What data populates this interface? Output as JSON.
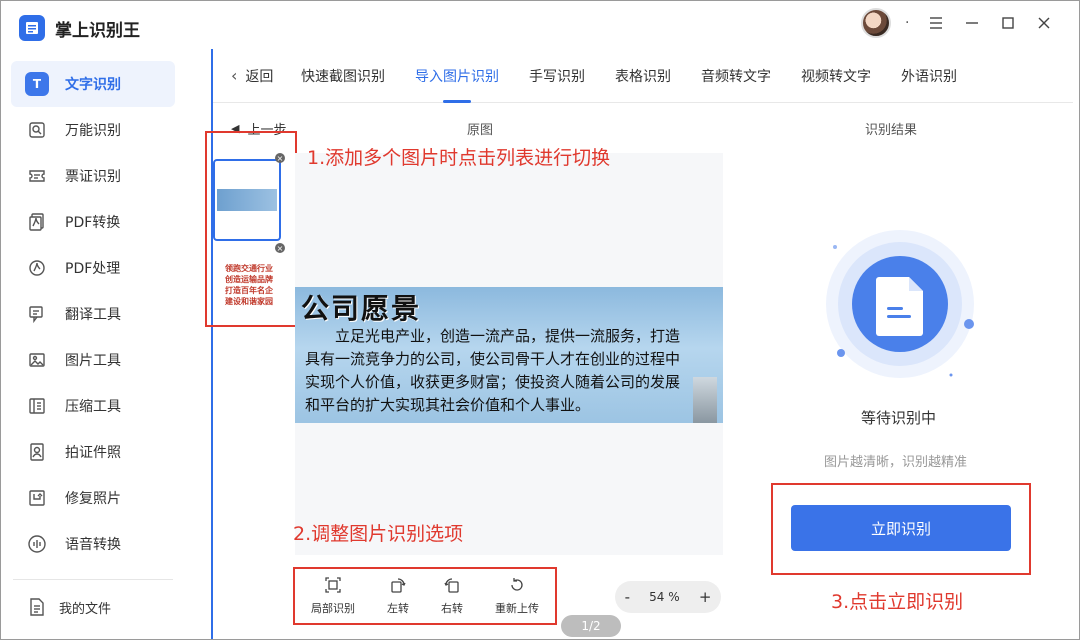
{
  "app": {
    "title": "掌上识别王"
  },
  "sidebar": {
    "items": [
      {
        "label": "文字识别",
        "icon": "text-recognition-icon",
        "active": true
      },
      {
        "label": "万能识别",
        "icon": "universal-scan-icon"
      },
      {
        "label": "票证识别",
        "icon": "ticket-icon"
      },
      {
        "label": "PDF转换",
        "icon": "pdf-convert-icon"
      },
      {
        "label": "PDF处理",
        "icon": "pdf-process-icon"
      },
      {
        "label": "翻译工具",
        "icon": "translate-icon"
      },
      {
        "label": "图片工具",
        "icon": "image-tools-icon"
      },
      {
        "label": "压缩工具",
        "icon": "compress-icon"
      },
      {
        "label": "拍证件照",
        "icon": "id-photo-icon"
      },
      {
        "label": "修复照片",
        "icon": "repair-photo-icon"
      },
      {
        "label": "语音转换",
        "icon": "voice-convert-icon"
      }
    ],
    "my_files": "我的文件",
    "active_icon_letter": "T"
  },
  "winbar": {
    "dot": "·"
  },
  "tabs": {
    "back": "返回",
    "items": [
      {
        "label": "快速截图识别"
      },
      {
        "label": "导入图片识别",
        "active": true
      },
      {
        "label": "手写识别"
      },
      {
        "label": "表格识别"
      },
      {
        "label": "音频转文字"
      },
      {
        "label": "视频转文字"
      },
      {
        "label": "外语识别"
      }
    ]
  },
  "workspace": {
    "prev_step": "上一步",
    "original_label": "原图",
    "result_label": "识别结果",
    "page_indicator": "1/2",
    "zoom": {
      "minus": "-",
      "value": "54 %",
      "plus": "+"
    }
  },
  "thumbnails": {
    "thumb2_lines": [
      "领跑交通行业",
      "创造运输品牌",
      "打造百年名企",
      "建设和谐家园"
    ]
  },
  "image_content": {
    "title": "公司愿景",
    "lines": [
      "立足光电产业，创造一流产品，提供一流服务，打造",
      "具有一流竞争力的公司，使公司骨干人才在创业的过程中",
      "实现个人价值，收获更多财富；使投资人随着公司的发展",
      "和平台的扩大实现其社会价值和个人事业。"
    ]
  },
  "tools": [
    {
      "label": "局部识别",
      "icon": "crop-icon"
    },
    {
      "label": "左转",
      "icon": "rotate-left-icon"
    },
    {
      "label": "右转",
      "icon": "rotate-right-icon"
    },
    {
      "label": "重新上传",
      "icon": "reupload-icon"
    }
  ],
  "result": {
    "status": "等待识别中",
    "hint": "图片越清晰，识别越精准",
    "button": "立即识别"
  },
  "annotations": {
    "a1": "1.添加多个图片时点击列表进行切换",
    "a2": "2.调整图片识别选项",
    "a3": "3.点击立即识别"
  },
  "colors": {
    "accent": "#2f6ee8",
    "annotation": "#e0392e"
  }
}
